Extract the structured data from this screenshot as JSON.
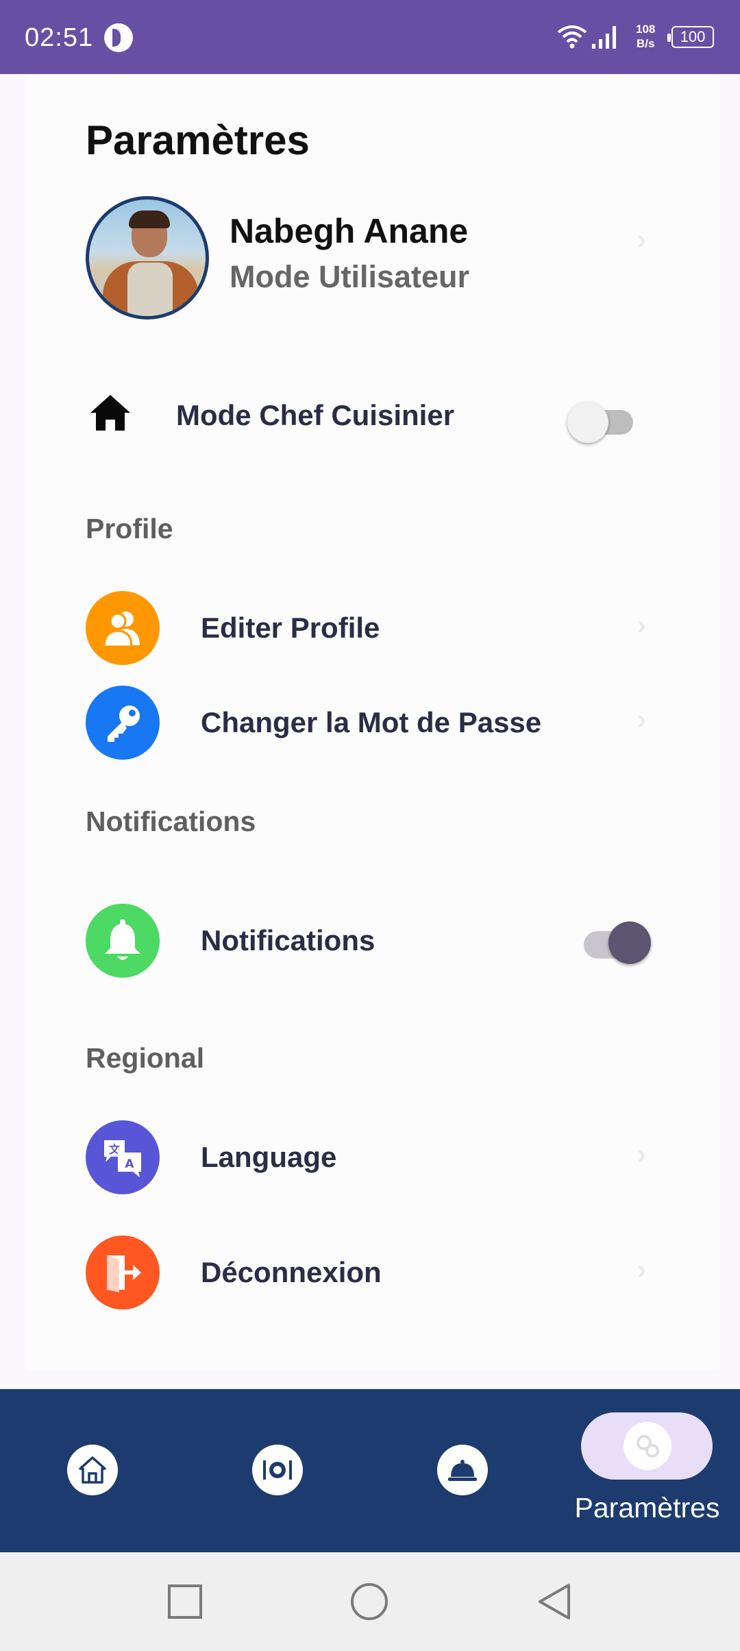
{
  "status_bar": {
    "time": "02:51",
    "speed_value": "108",
    "speed_unit": "B/s",
    "battery": "100"
  },
  "page": {
    "title": "Paramètres"
  },
  "profile": {
    "name": "Nabegh Anane",
    "mode": "Mode Utilisateur"
  },
  "chef_mode": {
    "label": "Mode Chef Cuisinier",
    "enabled": false
  },
  "sections": {
    "profile_title": "Profile",
    "notifications_title": "Notifications",
    "regional_title": "Regional"
  },
  "items": {
    "edit_profile": "Editer Profile",
    "change_password": "Changer la Mot de Passe",
    "notifications": "Notifications",
    "language": "Language",
    "logout": "Déconnexion"
  },
  "notifications_enabled": true,
  "bottom_nav": {
    "active_label": "Paramètres"
  },
  "colors": {
    "status_bar": "#6750a4",
    "nav_bar": "#1d3b6e",
    "edit_profile_icon": "#ff9800",
    "password_icon": "#1877f2",
    "notifications_icon": "#4cd964",
    "language_icon": "#5856d6",
    "logout_icon": "#ff5722"
  },
  "icons": {
    "chef_mode": "home-icon",
    "edit_profile": "users-icon",
    "password": "key-icon",
    "notifications": "bell-icon",
    "language": "translate-icon",
    "logout": "door-exit-icon"
  }
}
